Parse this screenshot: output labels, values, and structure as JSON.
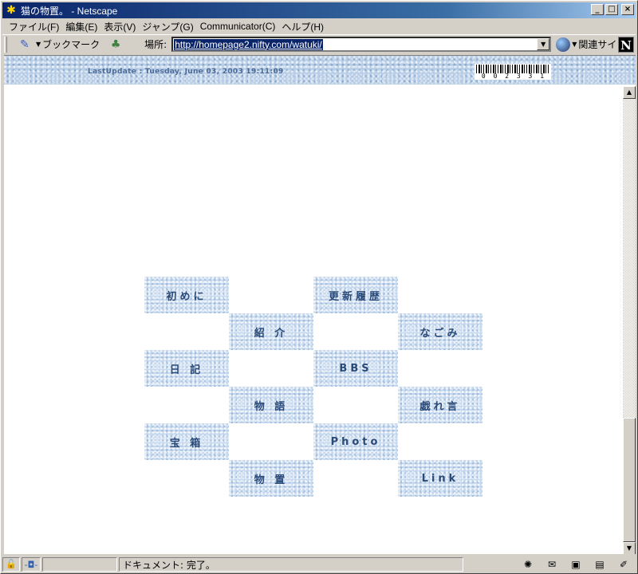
{
  "window": {
    "title": "猫の物置。 - Netscape",
    "app_icon": "netscape-app-icon",
    "controls": {
      "minimize": "_",
      "maximize": "□",
      "close": "×"
    }
  },
  "menu": [
    "ファイル(F)",
    "編集(E)",
    "表示(V)",
    "ジャンプ(G)",
    "Communicator(C)",
    "ヘルプ(H)"
  ],
  "location_bar": {
    "bookmarks_label": "ブックマーク",
    "location_label": "場所:",
    "url": "http://homepage2.nifty.com/watuki/",
    "related_label": "関連サイト",
    "logo": "N"
  },
  "page": {
    "last_update": "LastUpdate : Tuesday, June 03, 2003 19:11:09",
    "counter_digits": [
      "0",
      "0",
      "2",
      "3",
      "3",
      "1"
    ],
    "nav": [
      {
        "label": "初めに"
      },
      {
        "label": "更新履歴"
      },
      {
        "label": "紹 介"
      },
      {
        "label": "なごみ"
      },
      {
        "label": "日 記"
      },
      {
        "label": "BBS"
      },
      {
        "label": "物 語"
      },
      {
        "label": "戯れ言"
      },
      {
        "label": "宝 箱"
      },
      {
        "label": "Photo"
      },
      {
        "label": "物 置"
      },
      {
        "label": "Link"
      }
    ]
  },
  "status": {
    "text": "ドキュメント: 完了。"
  }
}
